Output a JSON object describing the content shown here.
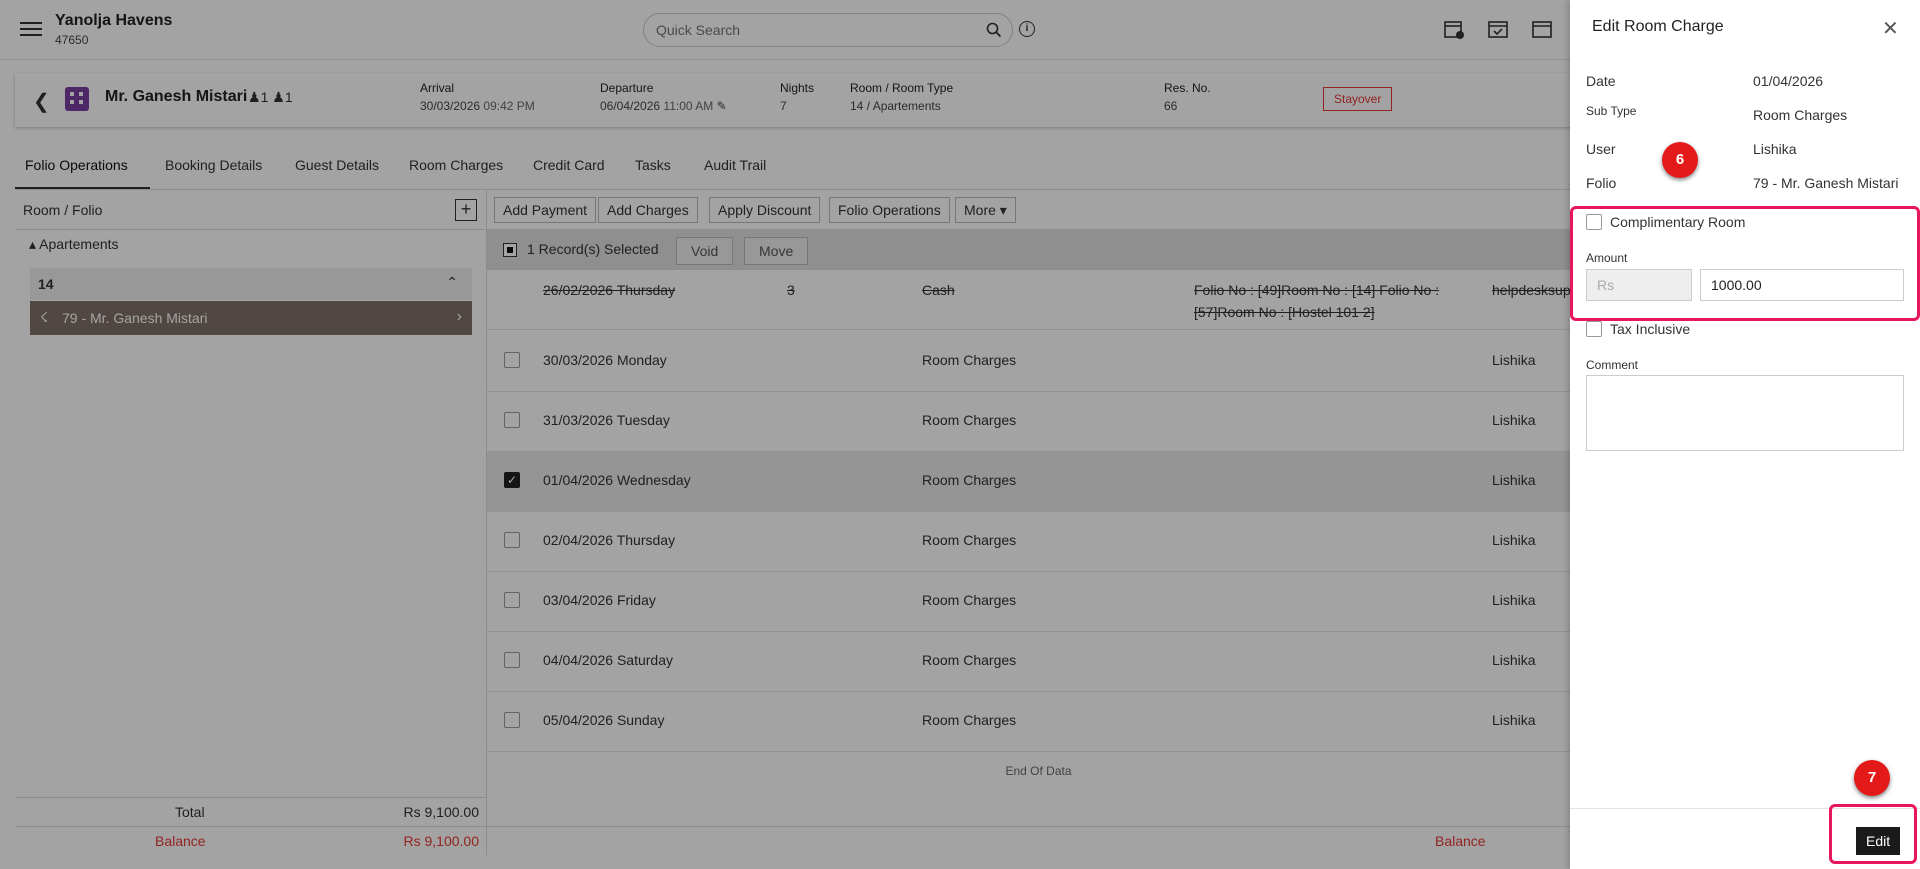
{
  "header": {
    "hotel_name": "Yanolja Havens",
    "hotel_id": "47650",
    "search_placeholder": "Quick Search"
  },
  "reservation": {
    "guest_name": "Mr. Ganesh Mistari",
    "adults": "1",
    "children": "1",
    "arrival_label": "Arrival",
    "arrival_date": "30/03/2026",
    "arrival_time": "09:42 PM",
    "departure_label": "Departure",
    "departure_date": "06/04/2026",
    "departure_time": "11:00 AM",
    "nights_label": "Nights",
    "nights": "7",
    "room_label": "Room / Room Type",
    "room_value": "14 / Apartements",
    "resno_label": "Res. No.",
    "resno": "66",
    "status": "Stayover"
  },
  "tabs": [
    "Folio Operations",
    "Booking Details",
    "Guest Details",
    "Room Charges",
    "Credit Card",
    "Tasks",
    "Audit Trail"
  ],
  "left": {
    "title": "Room / Folio",
    "group": "Apartements",
    "room": "14",
    "folio": "79 - Mr. Ganesh Mistari",
    "total_label": "Total",
    "total_value": "Rs 9,100.00",
    "balance_label": "Balance",
    "balance_value": "Rs 9,100.00"
  },
  "actions": [
    "Add Payment",
    "Add Charges",
    "Apply Discount",
    "Folio Operations",
    "More"
  ],
  "selection": {
    "text": "1 Record(s) Selected",
    "void": "Void",
    "move": "Move"
  },
  "rows": [
    {
      "date": "26/02/2026 Thursday",
      "num": "3",
      "type": "Cash",
      "desc1": "Folio No : [49]Room No : [14] Folio No :",
      "desc2": "[57]Room No : [Hostel 101 2]",
      "user": "helpdesksup"
    },
    {
      "date": "30/03/2026 Monday",
      "type": "Room Charges",
      "user": "Lishika"
    },
    {
      "date": "31/03/2026 Tuesday",
      "type": "Room Charges",
      "user": "Lishika"
    },
    {
      "date": "01/04/2026 Wednesday",
      "type": "Room Charges",
      "user": "Lishika"
    },
    {
      "date": "02/04/2026 Thursday",
      "type": "Room Charges",
      "user": "Lishika"
    },
    {
      "date": "03/04/2026 Friday",
      "type": "Room Charges",
      "user": "Lishika"
    },
    {
      "date": "04/04/2026 Saturday",
      "type": "Room Charges",
      "user": "Lishika"
    },
    {
      "date": "05/04/2026 Sunday",
      "type": "Room Charges",
      "user": "Lishika"
    }
  ],
  "end_of_data": "End Of Data",
  "right_balance_label": "Balance",
  "panel": {
    "title": "Edit Room Charge",
    "date_label": "Date",
    "date_value": "01/04/2026",
    "subtype_label": "Sub Type",
    "subtype_value": "Room Charges",
    "user_label": "User",
    "user_value": "Lishika",
    "folio_label": "Folio",
    "folio_value": "79 - Mr. Ganesh Mistari",
    "complimentary_label": "Complimentary Room",
    "amount_label": "Amount",
    "currency": "Rs",
    "amount_value": "1000.00",
    "tax_inclusive_label": "Tax Inclusive",
    "comment_label": "Comment",
    "edit_button": "Edit"
  },
  "annotations": {
    "step_6": "6",
    "step_7": "7",
    "highlight_color": "#e8175d",
    "badge_color": "#e41919"
  },
  "colors": {
    "accent_dark": "#1a1a1a",
    "status_red": "#e53935",
    "folio_item_bg": "#7d7068"
  }
}
